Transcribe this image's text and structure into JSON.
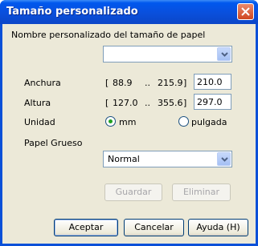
{
  "window": {
    "title": "Tamaño personalizado"
  },
  "name_section": {
    "label": "Nombre personalizado del tamaño de papel",
    "combo_value": ""
  },
  "width": {
    "label": "Anchura",
    "range_open": "[",
    "min": "88.9",
    "sep": "..",
    "max": "215.9",
    "range_close": "]",
    "value": "210.0"
  },
  "height": {
    "label": "Altura",
    "range_open": "[",
    "min": "127.0",
    "sep": "..",
    "max": "355.6",
    "range_close": "]",
    "value": "297.0"
  },
  "unit": {
    "label": "Unidad",
    "options": [
      {
        "label": "mm",
        "selected": true
      },
      {
        "label": "pulgada",
        "selected": false
      }
    ]
  },
  "paper": {
    "label": "Papel Grueso",
    "value": "Normal"
  },
  "buttons": {
    "save": "Guardar",
    "delete": "Eliminar",
    "accept": "Aceptar",
    "cancel": "Cancelar",
    "help": "Ayuda (H)"
  },
  "colors": {
    "titlebar": "#0a50d8",
    "client": "#ece9d8",
    "radio_dot": "#21a121"
  }
}
